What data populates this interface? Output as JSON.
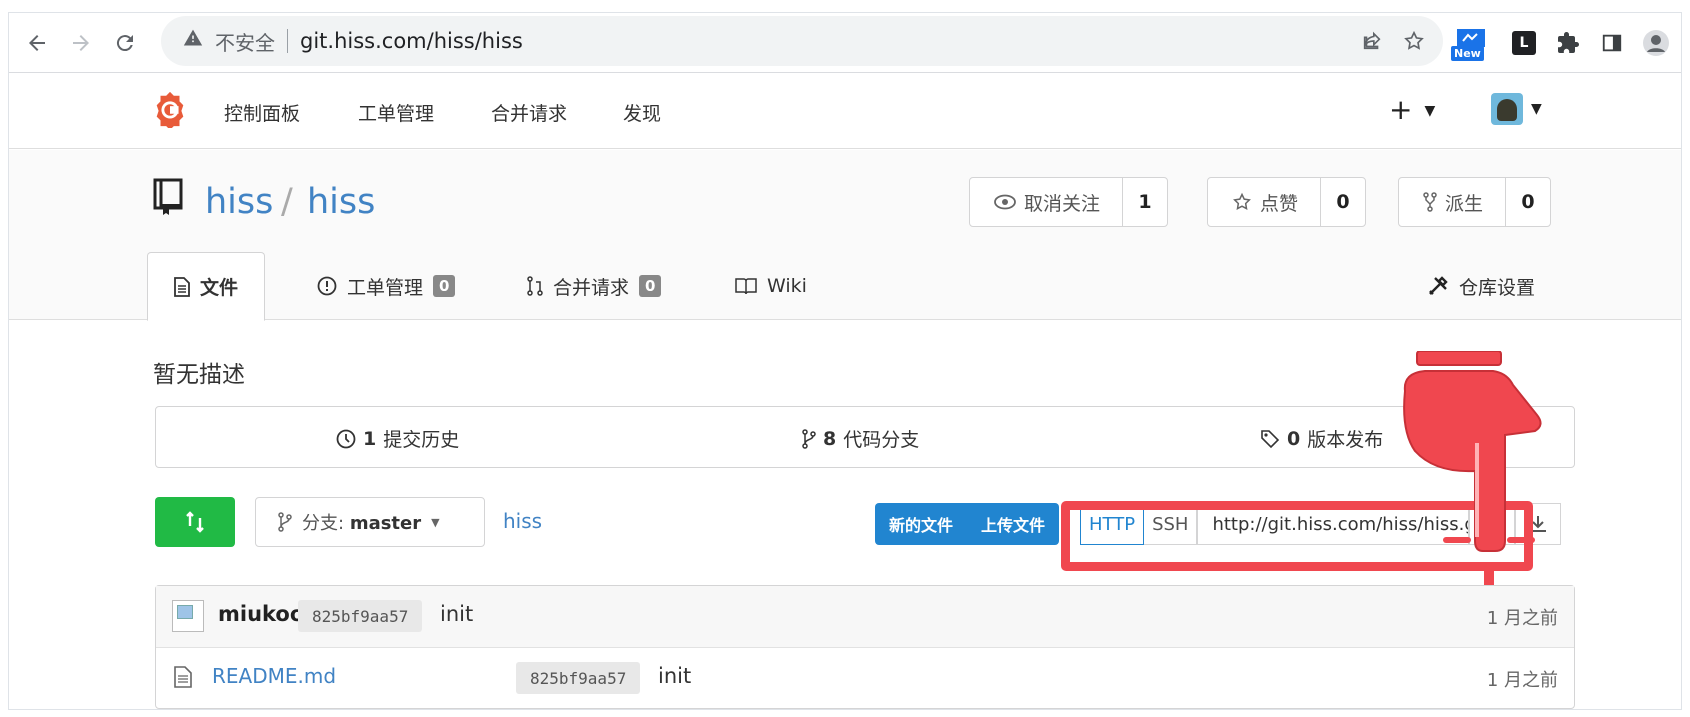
{
  "browser": {
    "insecure_label": "不安全",
    "url": "git.hiss.com/hiss/hiss",
    "new_badge": "New",
    "ext_letter": "L"
  },
  "nav": {
    "items": [
      "控制面板",
      "工单管理",
      "合并请求",
      "发现"
    ],
    "plus": "+"
  },
  "repo": {
    "owner": "hiss",
    "slash": "/",
    "name": "hiss",
    "watch": {
      "label": "取消关注",
      "count": "1"
    },
    "star": {
      "label": "点赞",
      "count": "0"
    },
    "fork": {
      "label": "派生",
      "count": "0"
    }
  },
  "tabs": [
    {
      "label": "文件"
    },
    {
      "label": "工单管理",
      "badge": "0"
    },
    {
      "label": "合并请求",
      "badge": "0"
    },
    {
      "label": "Wiki"
    },
    {
      "label": "仓库设置"
    }
  ],
  "description": "暂无描述",
  "stats": {
    "commits": {
      "count": "1",
      "label": "提交历史"
    },
    "branches": {
      "count": "8",
      "label": "代码分支"
    },
    "releases": {
      "count": "0",
      "label": "版本发布"
    }
  },
  "branch": {
    "prefix": "分支:",
    "name": "master"
  },
  "path_link": "hiss",
  "actions": {
    "new_file": "新的文件",
    "upload_file": "上传文件"
  },
  "clone": {
    "http": "HTTP",
    "ssh": "SSH",
    "url": "http://git.hiss.com/hiss/hiss.git"
  },
  "commit": {
    "author": "miukoo",
    "sha": "825bf9aa57",
    "message": "init",
    "age": "1 月之前"
  },
  "files": [
    {
      "name": "README.md",
      "sha": "825bf9aa57",
      "message": "init",
      "age": "1 月之前"
    }
  ],
  "colors": {
    "accent": "#4183c4",
    "primary": "#2185d0",
    "green": "#21ba45",
    "highlight": "#f0474f"
  }
}
